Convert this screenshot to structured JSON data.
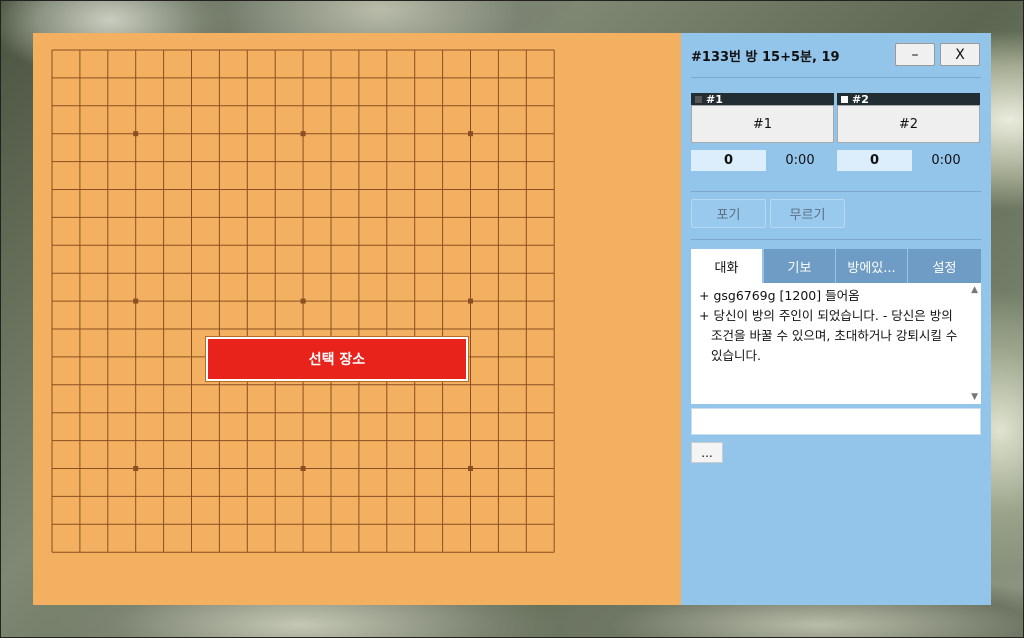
{
  "window": {
    "title": "#133번 방   15+5분, 19",
    "minimize_label": "–",
    "close_label": "X"
  },
  "board": {
    "size": 19,
    "overlay_label": "선택 장소"
  },
  "players": [
    {
      "head": "#1",
      "name": "#1",
      "score": "0",
      "time": "0:00"
    },
    {
      "head": "#2",
      "name": "#2",
      "score": "0",
      "time": "0:00"
    }
  ],
  "actions": {
    "resign": "포기",
    "undo": "무르기"
  },
  "tabs": [
    {
      "label": "대화",
      "active": true
    },
    {
      "label": "기보",
      "active": false
    },
    {
      "label": "방에있...",
      "active": false
    },
    {
      "label": "설정",
      "active": false
    }
  ],
  "chat": {
    "lines": [
      "+ gsg6769g [1200] 들어옴",
      "+ 당신이 방의 주인이 되었습니다. - 당신은 방의 조건을 바꿀 수 있으며, 초대하거나 강퇴시킬 수 있습니다."
    ],
    "input_value": "",
    "more_label": "..."
  },
  "colors": {
    "board": "#f2b060",
    "grid": "#8a4f22",
    "panel": "#93c4ea",
    "overlay": "#e8231b"
  }
}
